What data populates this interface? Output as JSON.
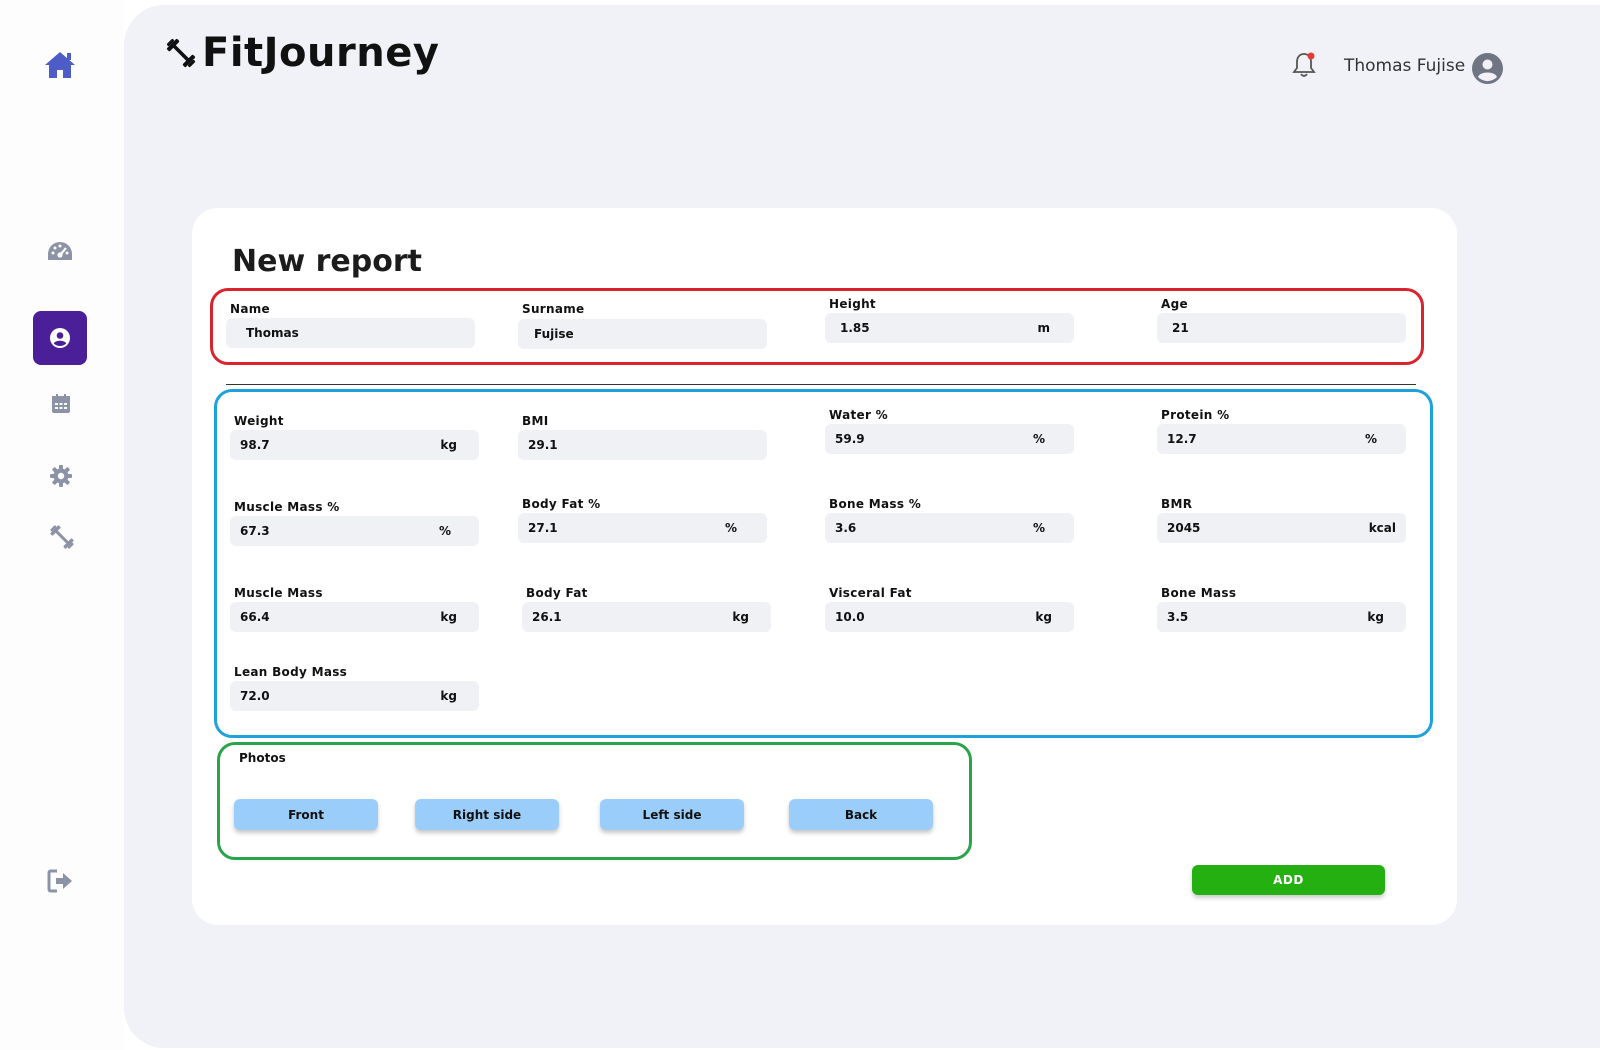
{
  "app": {
    "name": "FitJourney",
    "logo_icon": "dumbbell-icon"
  },
  "header": {
    "user_name": "Thomas Fujise",
    "notification_dot_color": "#e53935"
  },
  "sidebar": {
    "items": [
      {
        "icon": "home-icon"
      },
      {
        "icon": "dashboard-icon"
      },
      {
        "icon": "profile-icon",
        "active": true
      },
      {
        "icon": "calendar-icon"
      },
      {
        "icon": "settings-icon"
      },
      {
        "icon": "dumbbell-icon"
      },
      {
        "icon": "logout-icon"
      }
    ]
  },
  "form": {
    "title": "New report",
    "personal": {
      "name": {
        "label": "Name",
        "value": "Thomas"
      },
      "surname": {
        "label": "Surname",
        "value": "Fujise"
      },
      "height": {
        "label": "Height",
        "value": "1.85",
        "unit": "m"
      },
      "age": {
        "label": "Age",
        "value": "21"
      }
    },
    "metrics": {
      "weight": {
        "label": "Weight",
        "value": "98.7",
        "unit": "kg"
      },
      "bmi": {
        "label": "BMI",
        "value": "29.1"
      },
      "water": {
        "label": "Water %",
        "value": "59.9",
        "unit": "%"
      },
      "protein": {
        "label": "Protein %",
        "value": "12.7",
        "unit": "%"
      },
      "muscle_pct": {
        "label": "Muscle Mass %",
        "value": "67.3",
        "unit": "%"
      },
      "bodyfat_pct": {
        "label": "Body Fat %",
        "value": "27.1",
        "unit": "%"
      },
      "bone_pct": {
        "label": "Bone Mass %",
        "value": "3.6",
        "unit": "%"
      },
      "bmr": {
        "label": "BMR",
        "value": "2045",
        "unit": "kcal"
      },
      "muscle_mass": {
        "label": "Muscle Mass",
        "value": "66.4",
        "unit": "kg"
      },
      "body_fat": {
        "label": "Body Fat",
        "value": "26.1",
        "unit": "kg"
      },
      "visceral_fat": {
        "label": "Visceral Fat",
        "value": "10.0",
        "unit": "kg"
      },
      "bone_mass": {
        "label": "Bone Mass",
        "value": "3.5",
        "unit": "kg"
      },
      "lean_mass": {
        "label": "Lean Body Mass",
        "value": "72.0",
        "unit": "kg"
      }
    },
    "photos": {
      "label": "Photos",
      "buttons": {
        "front": "Front",
        "right": "Right side",
        "left": "Left side",
        "back": "Back"
      }
    },
    "add_label": "ADD"
  },
  "colors": {
    "accent": "#4a1f98",
    "photo_button": "#9bcdfa",
    "add_button": "#25b012",
    "outline_personal": "#d9242e",
    "outline_metrics": "#1ea2db",
    "outline_photos": "#2aa44a"
  }
}
